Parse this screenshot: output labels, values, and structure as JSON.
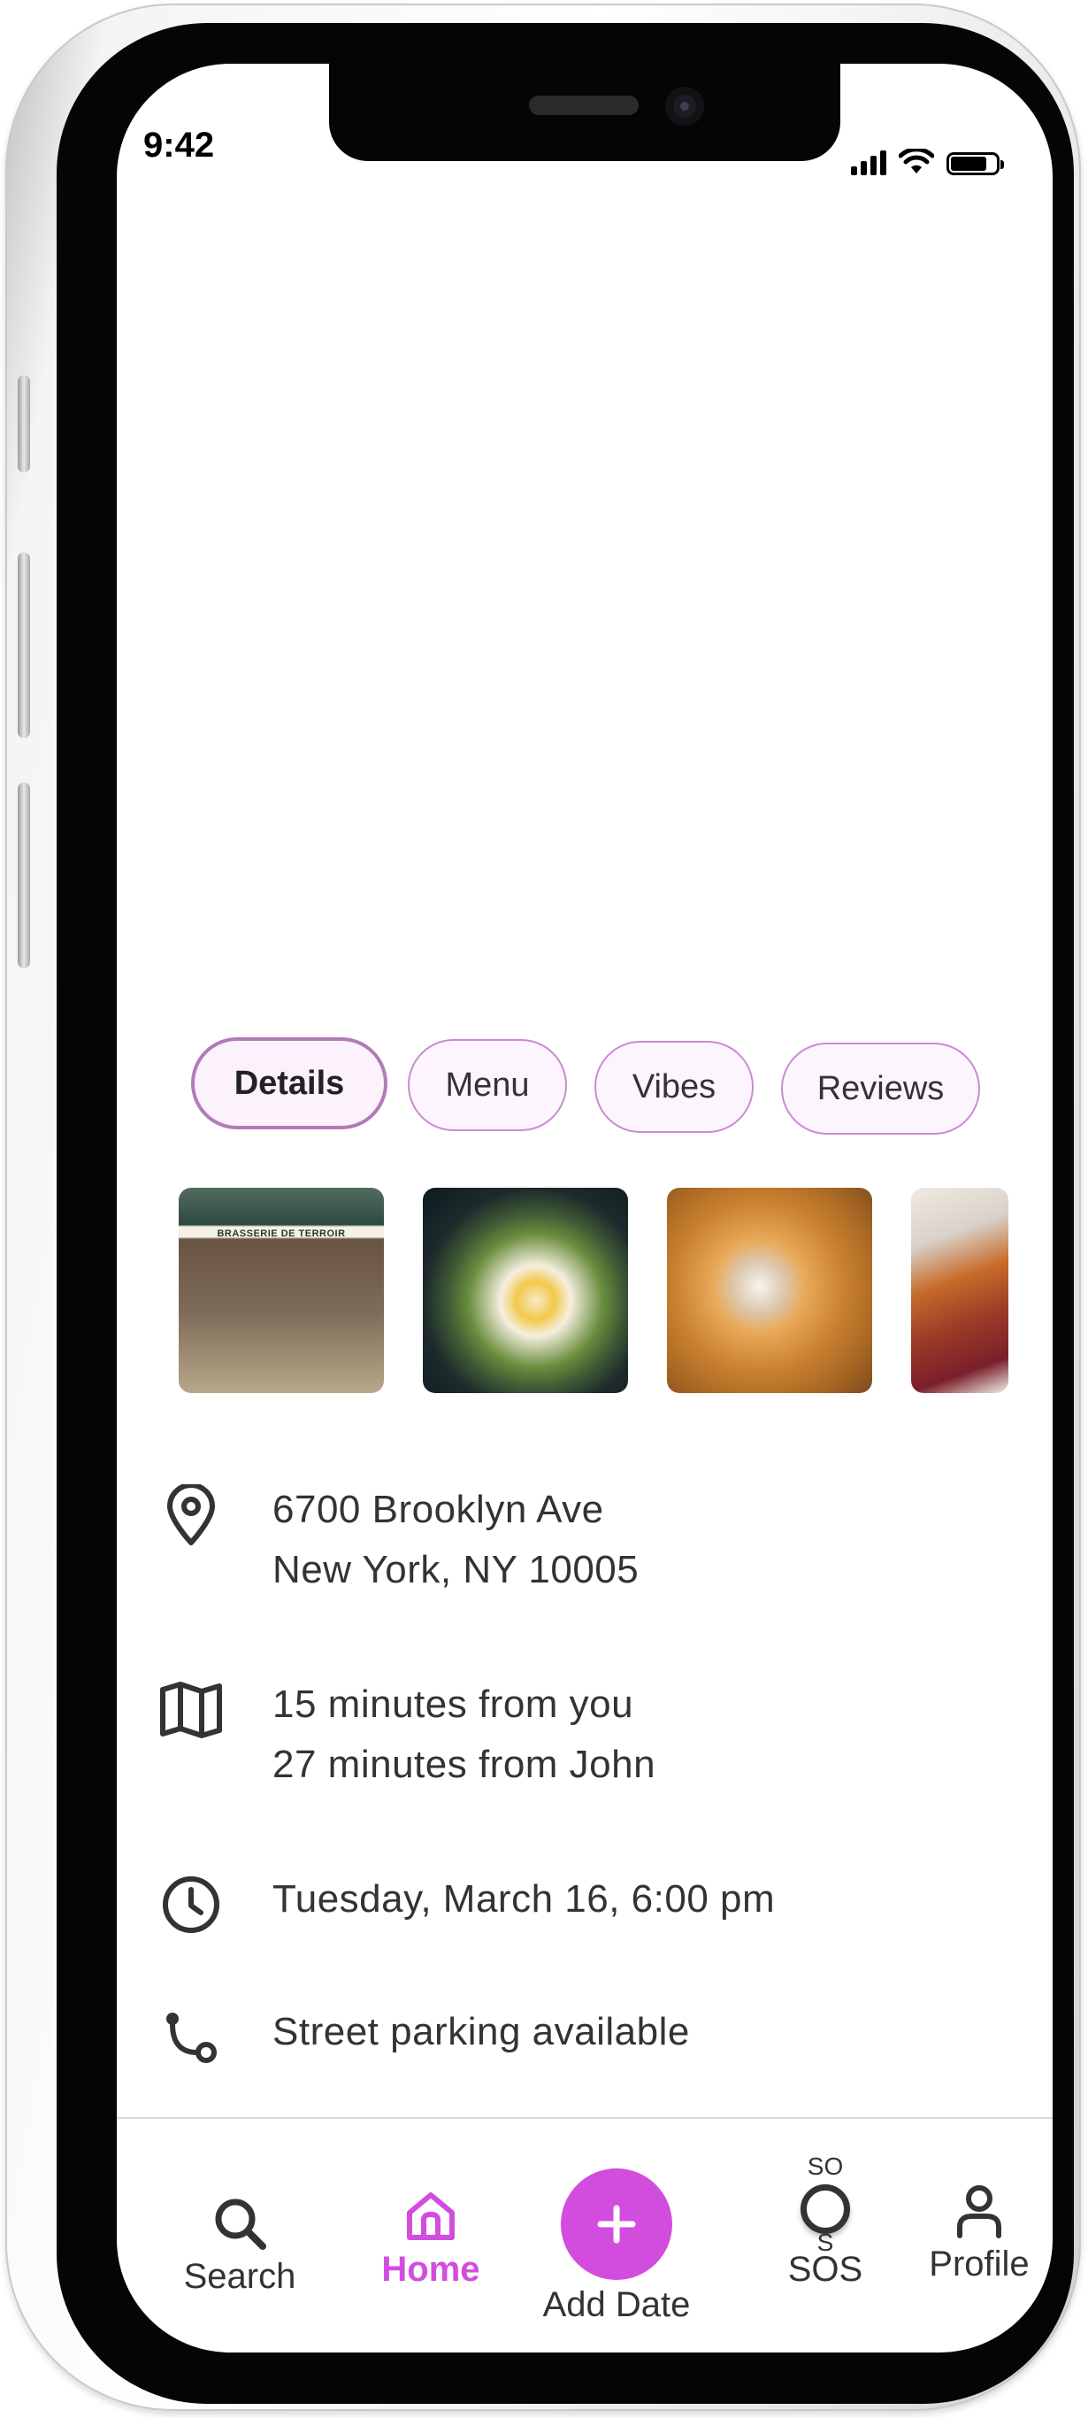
{
  "status_bar": {
    "time": "9:42"
  },
  "tabs": [
    {
      "label": "Details",
      "active": true
    },
    {
      "label": "Menu",
      "active": false
    },
    {
      "label": "Vibes",
      "active": false
    },
    {
      "label": "Reviews",
      "active": false
    }
  ],
  "gallery": {
    "sign_text": "BRASSERIE DE TERROIR",
    "photos": [
      "brasserie-storefront",
      "eggs-toast-plate",
      "pastries-coffee",
      "french-toast-berries"
    ]
  },
  "details": {
    "address_line1": "6700 Brooklyn Ave",
    "address_line2": "New York, NY 10005",
    "distance_you": "15 minutes from you",
    "distance_john": "27 minutes from John",
    "datetime": "Tuesday, March 16, 6:00 pm",
    "parking": "Street parking available"
  },
  "nav": {
    "search": "Search",
    "home": "Home",
    "add_date": "Add Date",
    "sos_top": "SO",
    "sos_mid": "S",
    "sos": "SOS",
    "profile": "Profile"
  },
  "colors": {
    "accent": "#d24dde",
    "tab_border": "#c98bd1",
    "tab_fill": "#fdf5fd",
    "text": "#333333"
  },
  "icons": [
    "location-pin-icon",
    "map-icon",
    "clock-icon",
    "route-icon",
    "search-icon",
    "home-icon",
    "plus-icon",
    "sos-icon",
    "profile-icon"
  ]
}
